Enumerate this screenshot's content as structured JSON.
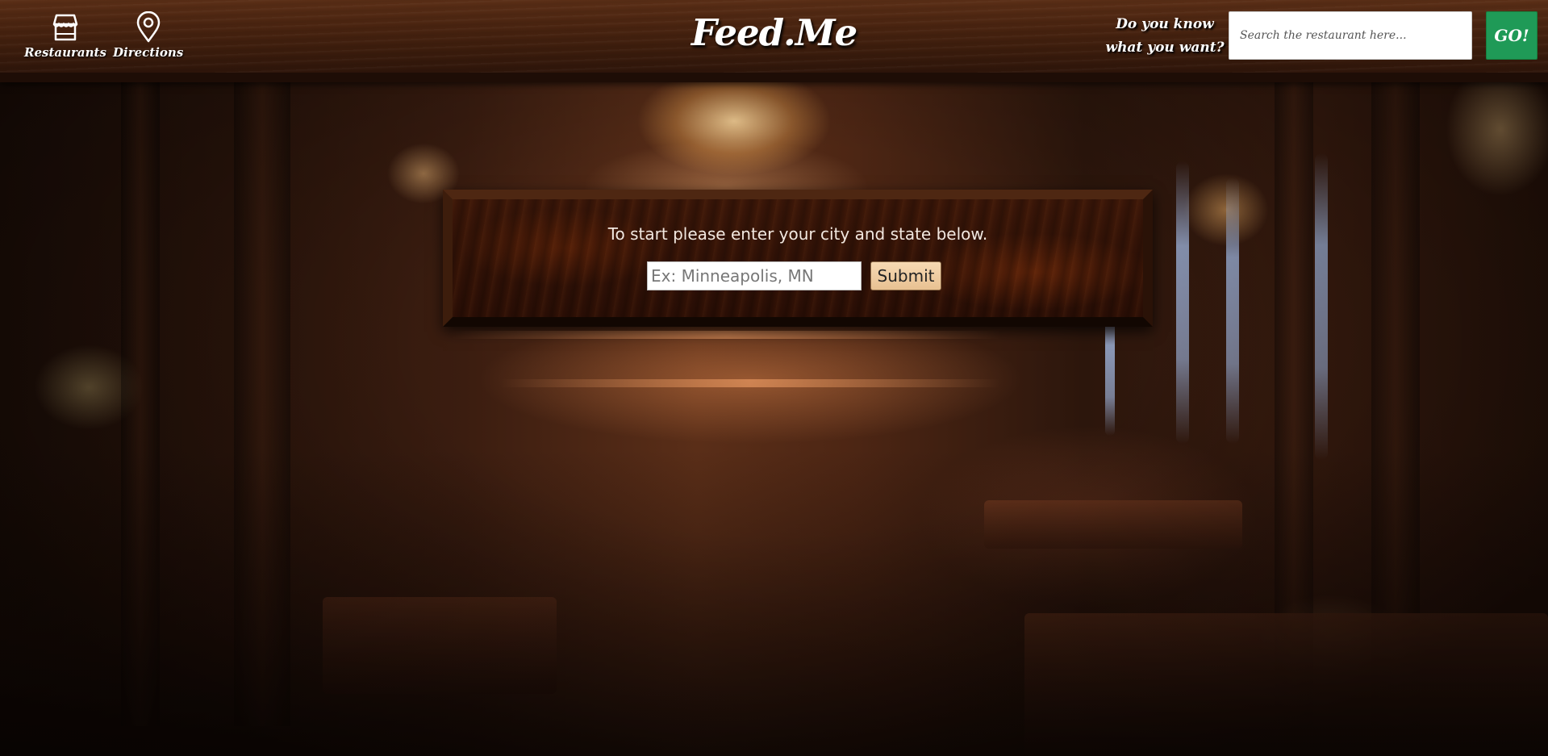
{
  "header": {
    "nav": [
      {
        "label": "Restaurants",
        "icon": "storefront-icon"
      },
      {
        "label": "Directions",
        "icon": "map-pin-icon"
      }
    ],
    "logo": "Feed.Me",
    "prompt_line1": "Do you know",
    "prompt_line2": "what you want?",
    "search": {
      "placeholder": "Search the restaurant here...",
      "value": ""
    },
    "go_label": "GO!"
  },
  "location_panel": {
    "instruction": "To start please enter your city and state below.",
    "city_input": {
      "placeholder": "Ex: Minneapolis, MN",
      "value": ""
    },
    "submit_label": "Submit"
  },
  "colors": {
    "go_button": "#1f9a57",
    "header_wood": "#4a2410",
    "panel_wood": "#2a0e05"
  }
}
